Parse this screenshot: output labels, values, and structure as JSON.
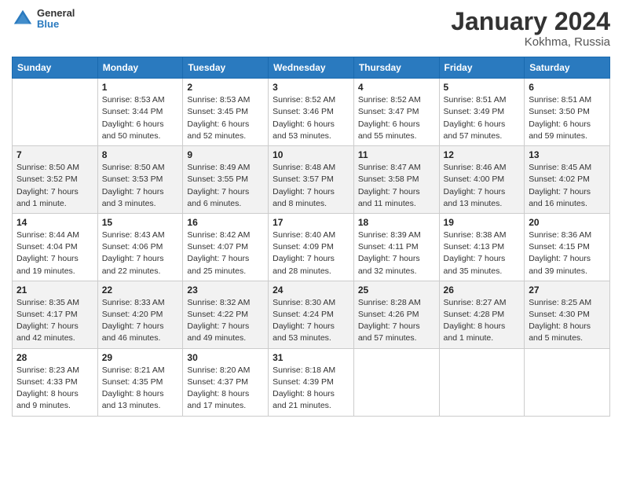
{
  "header": {
    "logo_line1": "General",
    "logo_line2": "Blue",
    "month_title": "January 2024",
    "location": "Kokhma, Russia"
  },
  "columns": [
    "Sunday",
    "Monday",
    "Tuesday",
    "Wednesday",
    "Thursday",
    "Friday",
    "Saturday"
  ],
  "weeks": [
    {
      "days": [
        {
          "number": "",
          "info": ""
        },
        {
          "number": "1",
          "info": "Sunrise: 8:53 AM\nSunset: 3:44 PM\nDaylight: 6 hours\nand 50 minutes."
        },
        {
          "number": "2",
          "info": "Sunrise: 8:53 AM\nSunset: 3:45 PM\nDaylight: 6 hours\nand 52 minutes."
        },
        {
          "number": "3",
          "info": "Sunrise: 8:52 AM\nSunset: 3:46 PM\nDaylight: 6 hours\nand 53 minutes."
        },
        {
          "number": "4",
          "info": "Sunrise: 8:52 AM\nSunset: 3:47 PM\nDaylight: 6 hours\nand 55 minutes."
        },
        {
          "number": "5",
          "info": "Sunrise: 8:51 AM\nSunset: 3:49 PM\nDaylight: 6 hours\nand 57 minutes."
        },
        {
          "number": "6",
          "info": "Sunrise: 8:51 AM\nSunset: 3:50 PM\nDaylight: 6 hours\nand 59 minutes."
        }
      ]
    },
    {
      "days": [
        {
          "number": "7",
          "info": "Sunrise: 8:50 AM\nSunset: 3:52 PM\nDaylight: 7 hours\nand 1 minute."
        },
        {
          "number": "8",
          "info": "Sunrise: 8:50 AM\nSunset: 3:53 PM\nDaylight: 7 hours\nand 3 minutes."
        },
        {
          "number": "9",
          "info": "Sunrise: 8:49 AM\nSunset: 3:55 PM\nDaylight: 7 hours\nand 6 minutes."
        },
        {
          "number": "10",
          "info": "Sunrise: 8:48 AM\nSunset: 3:57 PM\nDaylight: 7 hours\nand 8 minutes."
        },
        {
          "number": "11",
          "info": "Sunrise: 8:47 AM\nSunset: 3:58 PM\nDaylight: 7 hours\nand 11 minutes."
        },
        {
          "number": "12",
          "info": "Sunrise: 8:46 AM\nSunset: 4:00 PM\nDaylight: 7 hours\nand 13 minutes."
        },
        {
          "number": "13",
          "info": "Sunrise: 8:45 AM\nSunset: 4:02 PM\nDaylight: 7 hours\nand 16 minutes."
        }
      ]
    },
    {
      "days": [
        {
          "number": "14",
          "info": "Sunrise: 8:44 AM\nSunset: 4:04 PM\nDaylight: 7 hours\nand 19 minutes."
        },
        {
          "number": "15",
          "info": "Sunrise: 8:43 AM\nSunset: 4:06 PM\nDaylight: 7 hours\nand 22 minutes."
        },
        {
          "number": "16",
          "info": "Sunrise: 8:42 AM\nSunset: 4:07 PM\nDaylight: 7 hours\nand 25 minutes."
        },
        {
          "number": "17",
          "info": "Sunrise: 8:40 AM\nSunset: 4:09 PM\nDaylight: 7 hours\nand 28 minutes."
        },
        {
          "number": "18",
          "info": "Sunrise: 8:39 AM\nSunset: 4:11 PM\nDaylight: 7 hours\nand 32 minutes."
        },
        {
          "number": "19",
          "info": "Sunrise: 8:38 AM\nSunset: 4:13 PM\nDaylight: 7 hours\nand 35 minutes."
        },
        {
          "number": "20",
          "info": "Sunrise: 8:36 AM\nSunset: 4:15 PM\nDaylight: 7 hours\nand 39 minutes."
        }
      ]
    },
    {
      "days": [
        {
          "number": "21",
          "info": "Sunrise: 8:35 AM\nSunset: 4:17 PM\nDaylight: 7 hours\nand 42 minutes."
        },
        {
          "number": "22",
          "info": "Sunrise: 8:33 AM\nSunset: 4:20 PM\nDaylight: 7 hours\nand 46 minutes."
        },
        {
          "number": "23",
          "info": "Sunrise: 8:32 AM\nSunset: 4:22 PM\nDaylight: 7 hours\nand 49 minutes."
        },
        {
          "number": "24",
          "info": "Sunrise: 8:30 AM\nSunset: 4:24 PM\nDaylight: 7 hours\nand 53 minutes."
        },
        {
          "number": "25",
          "info": "Sunrise: 8:28 AM\nSunset: 4:26 PM\nDaylight: 7 hours\nand 57 minutes."
        },
        {
          "number": "26",
          "info": "Sunrise: 8:27 AM\nSunset: 4:28 PM\nDaylight: 8 hours\nand 1 minute."
        },
        {
          "number": "27",
          "info": "Sunrise: 8:25 AM\nSunset: 4:30 PM\nDaylight: 8 hours\nand 5 minutes."
        }
      ]
    },
    {
      "days": [
        {
          "number": "28",
          "info": "Sunrise: 8:23 AM\nSunset: 4:33 PM\nDaylight: 8 hours\nand 9 minutes."
        },
        {
          "number": "29",
          "info": "Sunrise: 8:21 AM\nSunset: 4:35 PM\nDaylight: 8 hours\nand 13 minutes."
        },
        {
          "number": "30",
          "info": "Sunrise: 8:20 AM\nSunset: 4:37 PM\nDaylight: 8 hours\nand 17 minutes."
        },
        {
          "number": "31",
          "info": "Sunrise: 8:18 AM\nSunset: 4:39 PM\nDaylight: 8 hours\nand 21 minutes."
        },
        {
          "number": "",
          "info": ""
        },
        {
          "number": "",
          "info": ""
        },
        {
          "number": "",
          "info": ""
        }
      ]
    }
  ]
}
